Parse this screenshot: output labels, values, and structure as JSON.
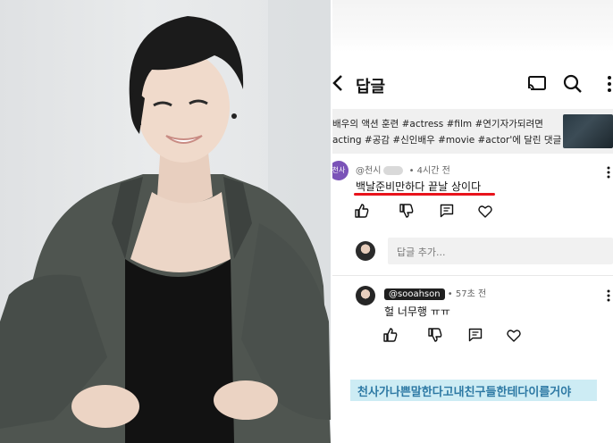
{
  "photo": {
    "description_icon": "portrait-photo"
  },
  "app": {
    "title": "답글",
    "icons": {
      "back": "back-arrow-icon",
      "cast": "cast-icon",
      "search": "search-icon",
      "more": "more-vertical-icon"
    }
  },
  "video": {
    "line1": "배우의 액션 훈련 #actress #film #연기자가되려면",
    "line2": "acting #공감 #신인배우 #movie #actor'에 달린 댓글"
  },
  "comment1": {
    "avatar_label": "천사",
    "author": "@천시",
    "time": "• 4시간 전",
    "text": "백날준비만하다 끝날 상이다"
  },
  "reply": {
    "placeholder": "답글 추가..."
  },
  "comment2": {
    "author": "@sooahson",
    "time": "• 57초 전",
    "text": "헐 너무행 ㅠㅠ"
  },
  "caption": {
    "text": "천사가나쁜말한다고내친구들한테다이를거야"
  },
  "colors": {
    "underline": "#e8131b",
    "caption_bg": "#cdecf4",
    "caption_text": "#2d79a4",
    "avatar": "#7b53b8"
  }
}
